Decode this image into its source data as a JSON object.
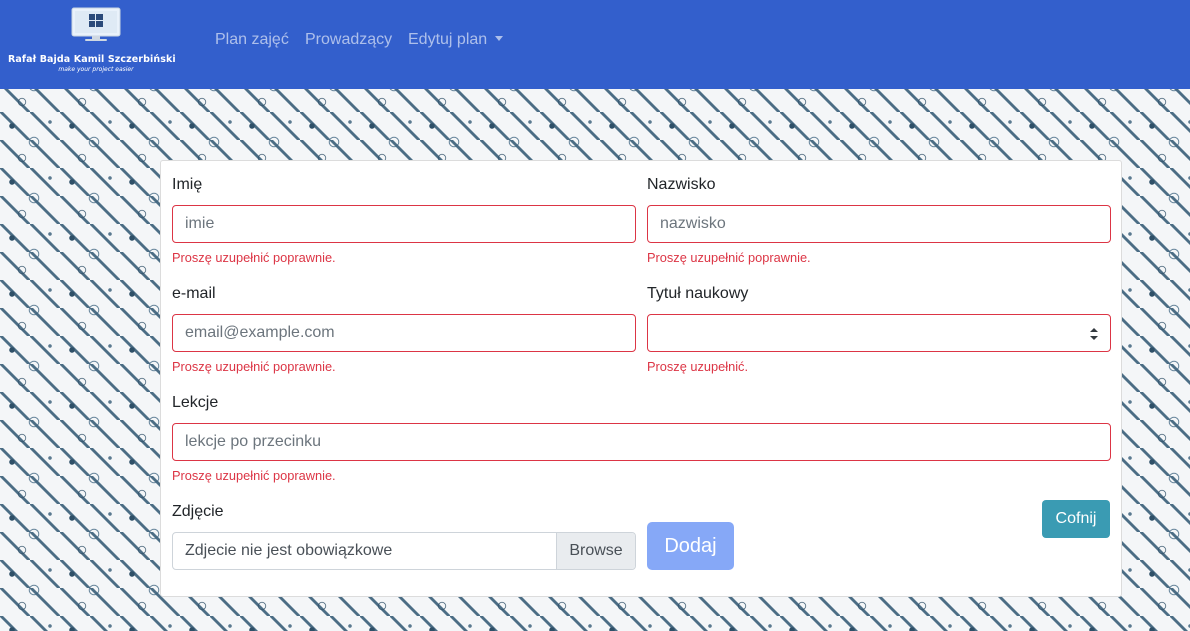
{
  "navbar": {
    "brand": {
      "name": "Rafał Bajda Kamil Szczerbiński",
      "tagline": "make your project easier",
      "icon": "monitor-windows-logo-icon"
    },
    "links": [
      {
        "label": "Plan zajęć"
      },
      {
        "label": "Prowadzący"
      },
      {
        "label": "Edytuj plan",
        "dropdown": true
      }
    ],
    "background_color": "#335fcc"
  },
  "form": {
    "first_name": {
      "label": "Imię",
      "placeholder": "imie",
      "error": "Proszę uzupełnić poprawnie."
    },
    "last_name": {
      "label": "Nazwisko",
      "placeholder": "nazwisko",
      "error": "Proszę uzupełnić poprawnie."
    },
    "email": {
      "label": "e-mail",
      "placeholder": "email@example.com",
      "error": "Proszę uzupełnić poprawnie."
    },
    "title": {
      "label": "Tytuł naukowy",
      "selected": "",
      "error": "Proszę uzupełnić."
    },
    "lessons": {
      "label": "Lekcje",
      "placeholder": "lekcje po przecinku",
      "error": "Proszę uzupełnić poprawnie."
    },
    "photo": {
      "label": "Zdjęcie",
      "text": "Zdjecie nie jest obowiązkowe",
      "browse": "Browse"
    },
    "submit": "Dodaj",
    "back": "Cofnij"
  },
  "colors": {
    "error": "#dc3545",
    "submit_button": "#86a8f7",
    "back_button": "#3a9bb3"
  }
}
